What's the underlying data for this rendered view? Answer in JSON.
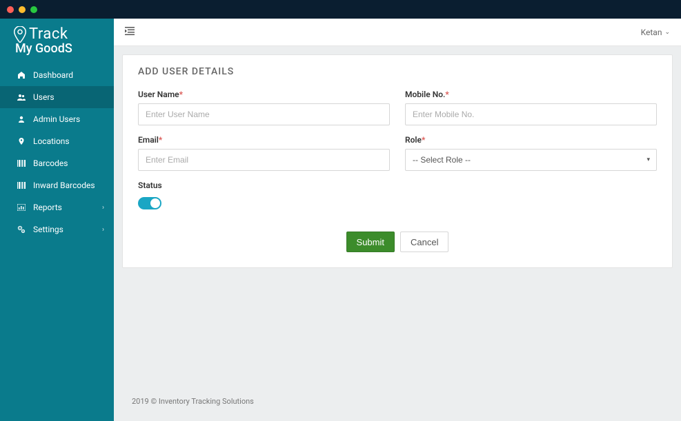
{
  "app": {
    "logo_line1": "Track",
    "logo_line2": "My GoodS"
  },
  "sidebar": {
    "items": [
      {
        "label": "Dashboard",
        "icon": "home-icon",
        "active": false,
        "expandable": false
      },
      {
        "label": "Users",
        "icon": "users-icon",
        "active": true,
        "expandable": false
      },
      {
        "label": "Admin Users",
        "icon": "user-icon",
        "active": false,
        "expandable": false
      },
      {
        "label": "Locations",
        "icon": "location-icon",
        "active": false,
        "expandable": false
      },
      {
        "label": "Barcodes",
        "icon": "barcode-icon",
        "active": false,
        "expandable": false
      },
      {
        "label": "Inward Barcodes",
        "icon": "barcode-icon",
        "active": false,
        "expandable": false
      },
      {
        "label": "Reports",
        "icon": "report-icon",
        "active": false,
        "expandable": true
      },
      {
        "label": "Settings",
        "icon": "gears-icon",
        "active": false,
        "expandable": true
      }
    ]
  },
  "topbar": {
    "user_name": "Ketan"
  },
  "page": {
    "title": "ADD USER DETAILS",
    "fields": {
      "username": {
        "label": "User Name",
        "placeholder": "Enter User Name",
        "value": ""
      },
      "mobile": {
        "label": "Mobile No.",
        "placeholder": "Enter Mobile No.",
        "value": ""
      },
      "email": {
        "label": "Email",
        "placeholder": "Enter Email",
        "value": ""
      },
      "role": {
        "label": "Role",
        "selected": "-- Select Role --"
      },
      "status": {
        "label": "Status",
        "on": true
      }
    },
    "buttons": {
      "submit": "Submit",
      "cancel": "Cancel"
    }
  },
  "footer": {
    "text": "2019 © Inventory Tracking Solutions"
  }
}
